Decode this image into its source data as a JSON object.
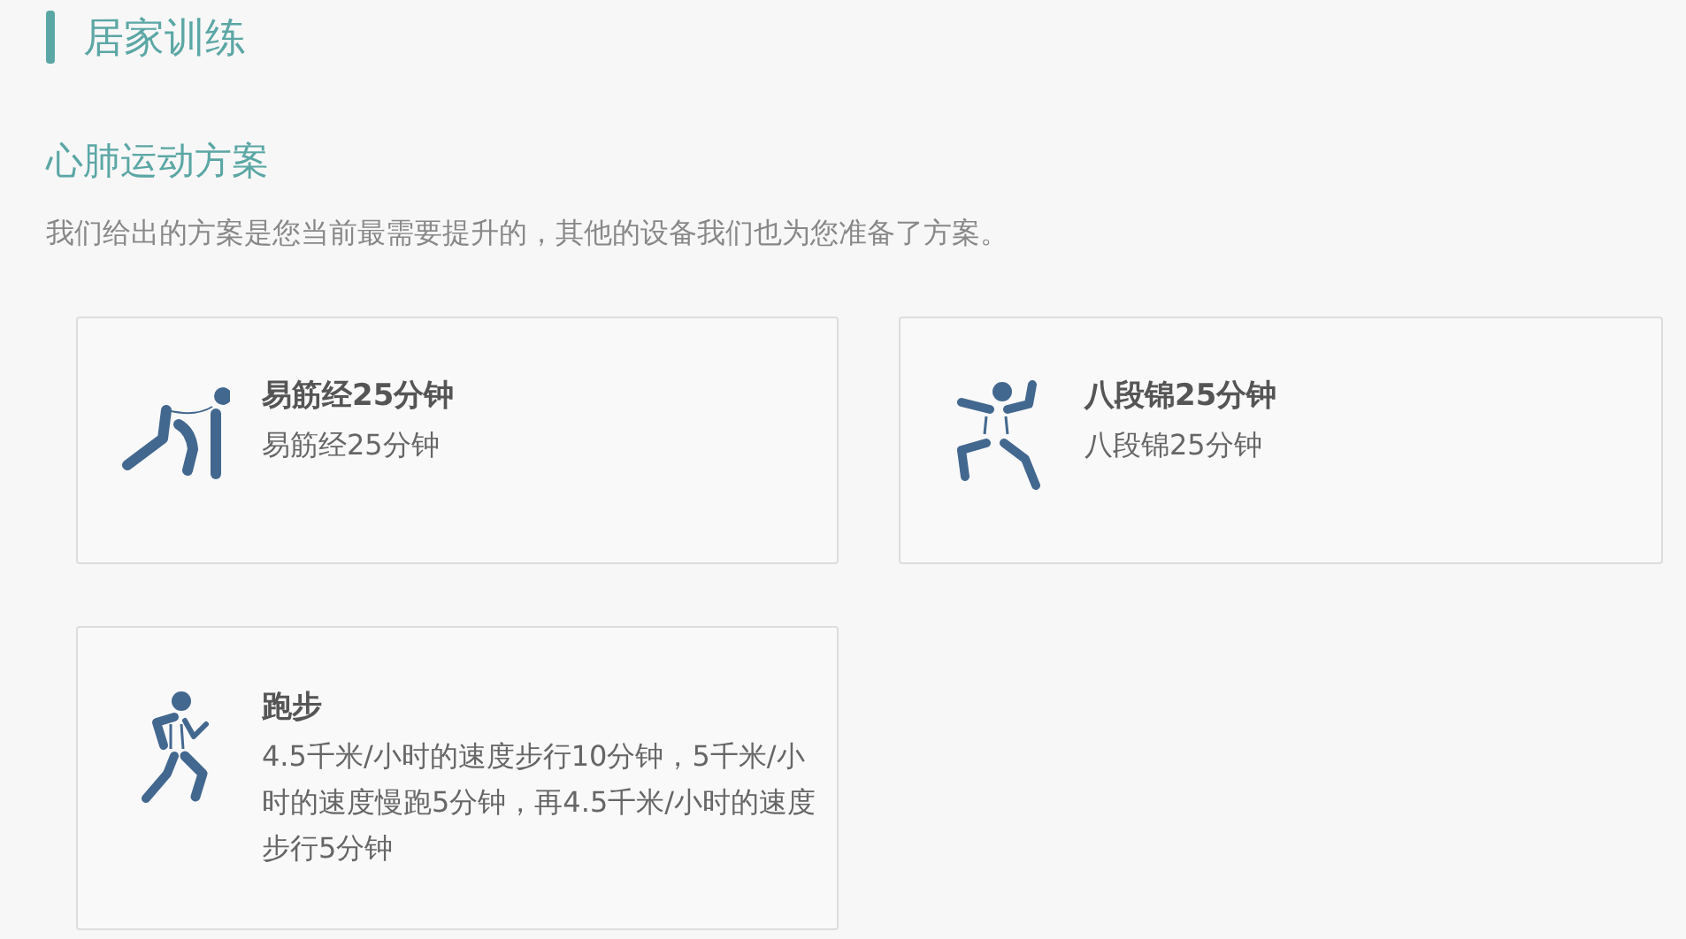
{
  "page_title": "居家训练",
  "section": {
    "title": "心肺运动方案",
    "description": "我们给出的方案是您当前最需要提升的，其他的设备我们也为您准备了方案。"
  },
  "plans": [
    {
      "kind": "stretch",
      "title": "易筋经25分钟",
      "description": "易筋经25分钟"
    },
    {
      "kind": "taichi",
      "title": "八段锦25分钟",
      "description": "八段锦25分钟"
    },
    {
      "kind": "run",
      "title": "跑步",
      "description": "4.5千米/小时的速度步行10分钟，5千米/小时的速度慢跑5分钟，再4.5千米/小时的速度步行5分钟"
    }
  ]
}
